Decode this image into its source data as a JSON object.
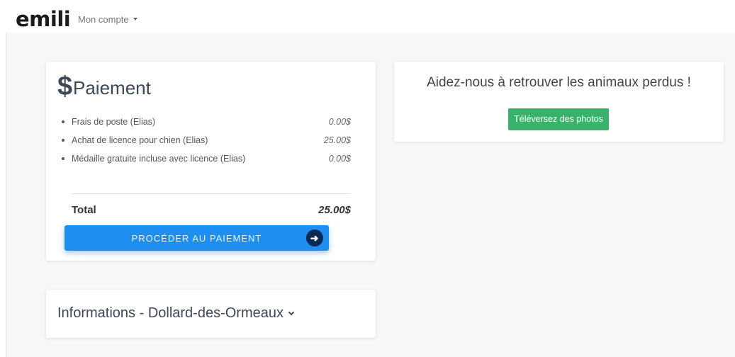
{
  "header": {
    "logo": "emili",
    "account_menu": "Mon compte"
  },
  "payment": {
    "title": "Paiement",
    "icon": "dollar-icon",
    "items": [
      {
        "label": "Frais de poste (Elias)",
        "amount": "0.00$"
      },
      {
        "label": "Achat de licence pour chien (Elias)",
        "amount": "25.00$"
      },
      {
        "label": "Médaille gratuite incluse avec licence (Elias)",
        "amount": "0.00$"
      }
    ],
    "total_label": "Total",
    "total_amount": "25.00$",
    "pay_button": "PROCÉDER AU PAIEMENT"
  },
  "lost_animals": {
    "title": "Aidez-nous à retrouver les animaux perdus !",
    "upload_button": "Téléversez des photos"
  },
  "info": {
    "title": "Informations - Dollard-des-Ormeaux"
  },
  "colors": {
    "primary_button": "#1e8ef0",
    "success_button": "#3bb26b",
    "heading": "#3d4756",
    "background": "#f7f7f7"
  }
}
